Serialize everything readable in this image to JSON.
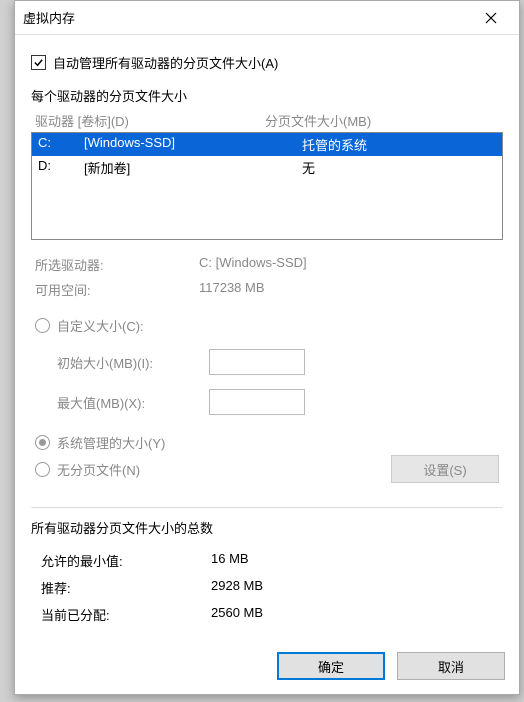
{
  "title": "虚拟内存",
  "auto_manage_label": "自动管理所有驱动器的分页文件大小(A)",
  "per_drive_label": "每个驱动器的分页文件大小",
  "header": {
    "drive": "驱动器 [卷标](D)",
    "paging": "分页文件大小(MB)"
  },
  "drives": [
    {
      "letter": "C:",
      "label": "[Windows-SSD]",
      "paging": "托管的系统"
    },
    {
      "letter": "D:",
      "label": "[新加卷]",
      "paging": "无"
    }
  ],
  "selected_drive_label": "所选驱动器:",
  "selected_drive_value": "C:  [Windows-SSD]",
  "available_label": "可用空间:",
  "available_value": "117238 MB",
  "custom_size_label": "自定义大小(C):",
  "initial_size_label": "初始大小(MB)(I):",
  "max_size_label": "最大值(MB)(X):",
  "system_managed_label": "系统管理的大小(Y)",
  "no_paging_label": "无分页文件(N)",
  "set_button": "设置(S)",
  "totals_label": "所有驱动器分页文件大小的总数",
  "min_allowed_label": "允许的最小值:",
  "min_allowed_value": "16 MB",
  "recommended_label": "推荐:",
  "recommended_value": "2928 MB",
  "current_label": "当前已分配:",
  "current_value": "2560 MB",
  "ok_button": "确定",
  "cancel_button": "取消"
}
